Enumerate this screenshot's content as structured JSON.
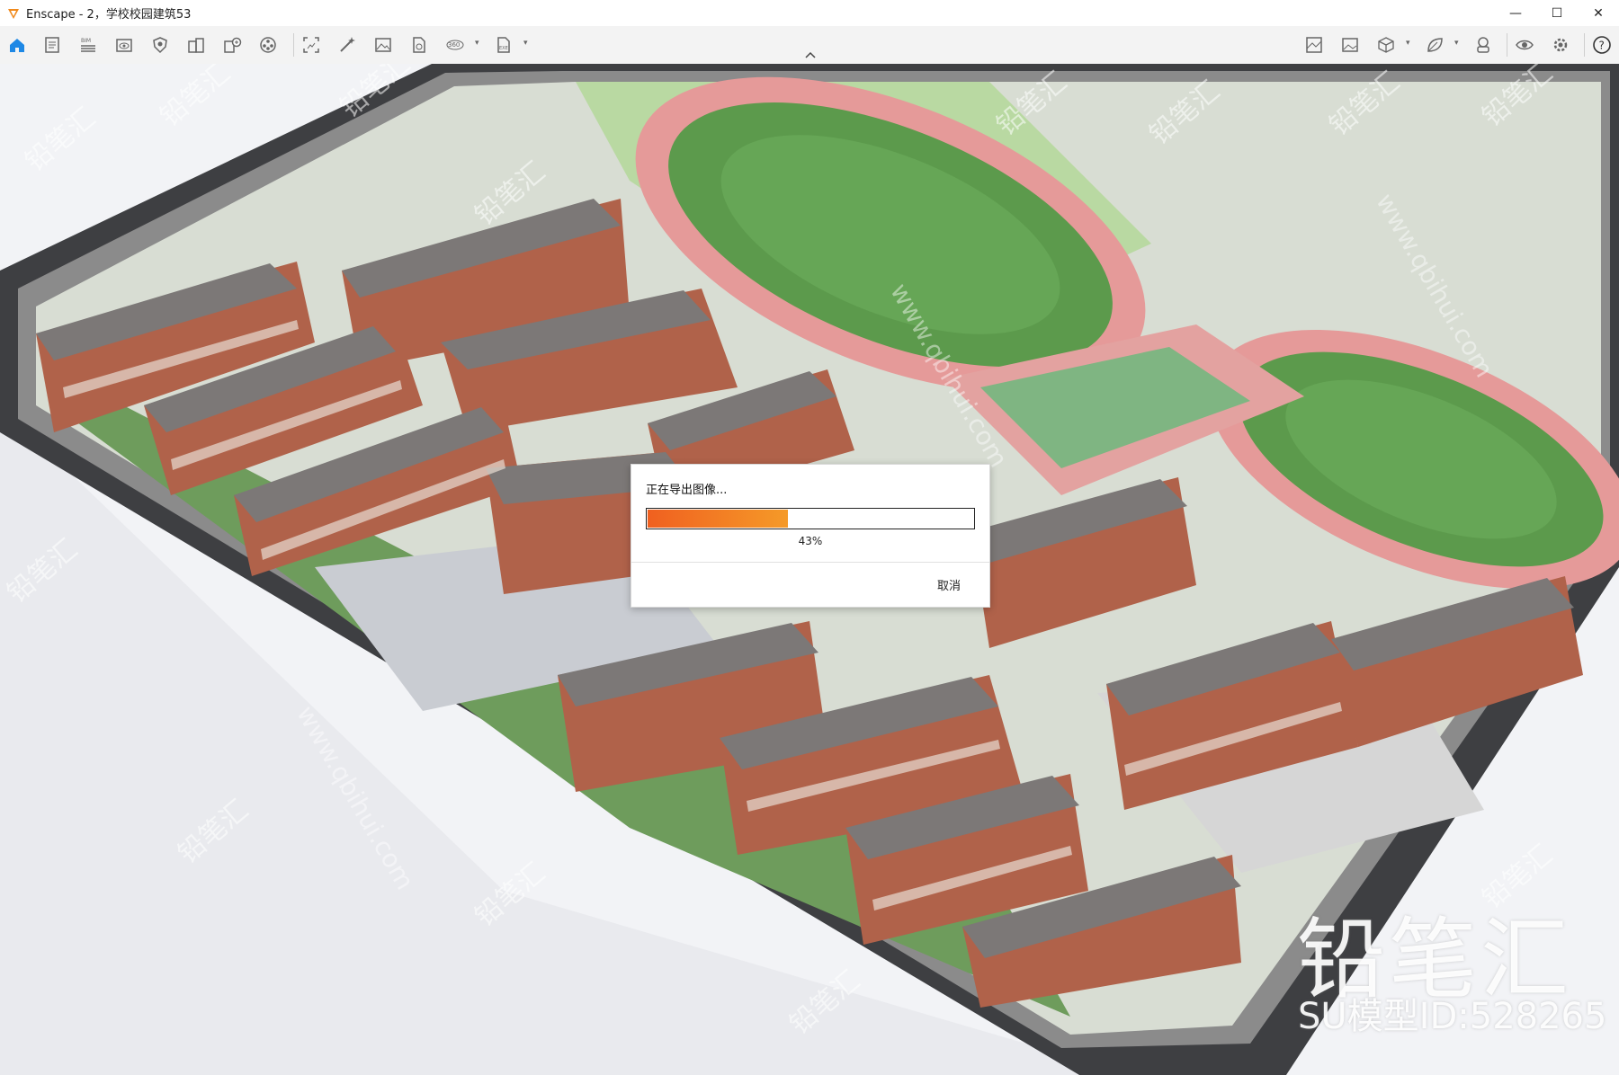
{
  "window": {
    "title": "Enscape - 2，学校校园建筑53",
    "minimize": "—",
    "maximize": "☐",
    "close": "✕"
  },
  "toolbar": {
    "left_icons": [
      "home-icon",
      "document-icon",
      "bim-icon",
      "view-eye-icon",
      "shield-icon",
      "building-icon",
      "add-building-icon",
      "asset-library-icon",
      "screenshot-icon",
      "magic-wand-icon",
      "image-icon",
      "export-file-icon",
      "panorama-360-icon",
      "exe-export-icon"
    ],
    "right_icons": [
      "map-icon",
      "landscape-icon",
      "cube-icon",
      "leaf-icon",
      "vr-headset-icon",
      "visibility-icon",
      "settings-icon",
      "help-icon"
    ],
    "bim_label": "BIM",
    "pano_label": "360",
    "exe_label": "EXE"
  },
  "dialog": {
    "title": "正在导出图像...",
    "progress": 0.43,
    "progress_label": "43%",
    "cancel_label": "取消"
  },
  "watermark": {
    "brand": "铅笔汇",
    "model_id": "SU模型ID:528265",
    "repeat_text": "铅笔汇",
    "url_text": "www.qbihui.com"
  },
  "colors": {
    "accent_orange": "#f06020",
    "progress_end": "#f59a28",
    "home_blue": "#1e88e5"
  }
}
